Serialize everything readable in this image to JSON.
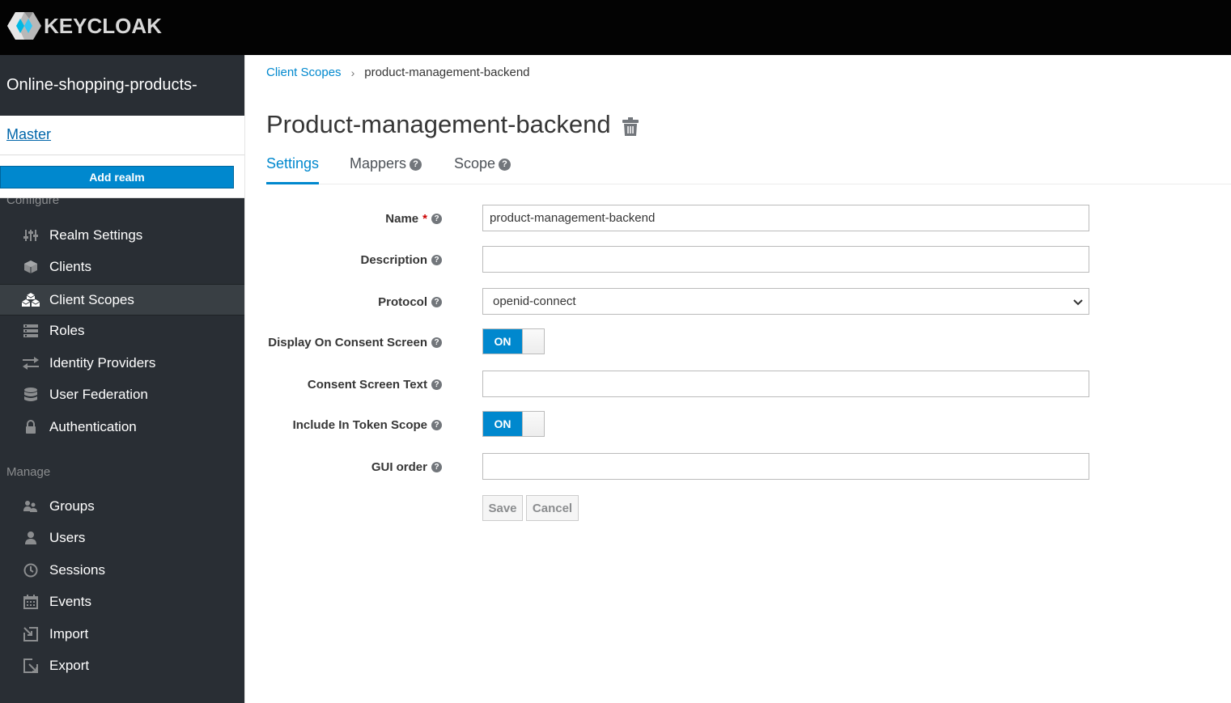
{
  "brand": {
    "logo_text": "KEYCLOAK"
  },
  "sidebar": {
    "realm_name": "Online-shopping-products-",
    "realm_menu": {
      "master": "Master",
      "add_realm": "Add realm"
    },
    "configure_label": "Configure",
    "configure_items": [
      {
        "label": "Realm Settings",
        "icon": "sliders-icon"
      },
      {
        "label": "Clients",
        "icon": "cube-icon"
      },
      {
        "label": "Client Scopes",
        "icon": "cubes-icon",
        "active": true
      },
      {
        "label": "Roles",
        "icon": "list-icon"
      },
      {
        "label": "Identity Providers",
        "icon": "exchange-icon"
      },
      {
        "label": "User Federation",
        "icon": "database-icon"
      },
      {
        "label": "Authentication",
        "icon": "lock-icon"
      }
    ],
    "manage_label": "Manage",
    "manage_items": [
      {
        "label": "Groups",
        "icon": "users-icon"
      },
      {
        "label": "Users",
        "icon": "user-icon"
      },
      {
        "label": "Sessions",
        "icon": "clock-icon"
      },
      {
        "label": "Events",
        "icon": "calendar-icon"
      },
      {
        "label": "Import",
        "icon": "import-icon"
      },
      {
        "label": "Export",
        "icon": "export-icon"
      }
    ]
  },
  "breadcrumb": {
    "parent": "Client Scopes",
    "separator": "›",
    "current": "product-management-backend"
  },
  "page": {
    "title": "Product-management-backend"
  },
  "tabs": [
    {
      "label": "Settings",
      "active": true
    },
    {
      "label": "Mappers",
      "help": true
    },
    {
      "label": "Scope",
      "help": true
    }
  ],
  "form": {
    "name": {
      "label": "Name",
      "required_mark": "*",
      "value": "product-management-backend"
    },
    "description": {
      "label": "Description",
      "value": ""
    },
    "protocol": {
      "label": "Protocol",
      "value": "openid-connect"
    },
    "display_on_consent": {
      "label": "Display On Consent Screen",
      "value": "ON"
    },
    "consent_text": {
      "label": "Consent Screen Text",
      "value": ""
    },
    "include_in_token_scope": {
      "label": "Include In Token Scope",
      "value": "ON"
    },
    "gui_order": {
      "label": "GUI order",
      "value": ""
    },
    "save_label": "Save",
    "cancel_label": "Cancel"
  },
  "help_glyph": "?",
  "colors": {
    "accent": "#0088ce",
    "sidebar_bg": "#292e34",
    "topbar_bg": "#030303"
  }
}
